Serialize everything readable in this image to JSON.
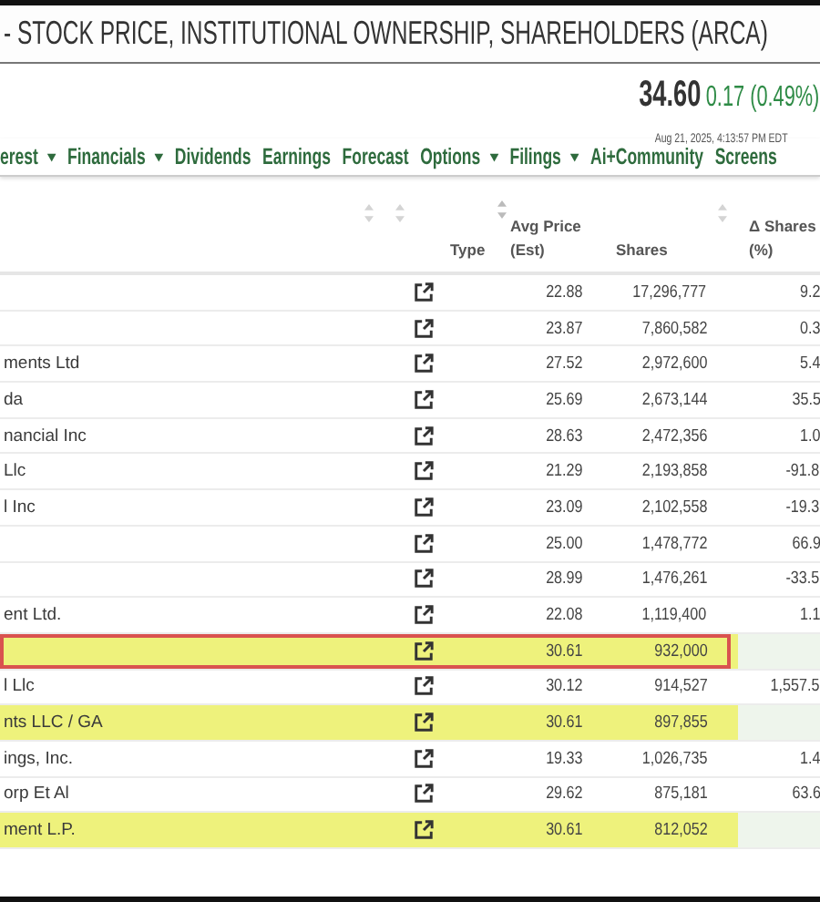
{
  "page_title": "- STOCK PRICE, INSTITUTIONAL OWNERSHIP, SHAREHOLDERS (ARCA)",
  "quote": {
    "price": "34.60",
    "change": "0.17 (0.49%)",
    "timestamp": "Aug 21, 2025, 4:13:57 PM EDT"
  },
  "nav": [
    {
      "label": "erest",
      "dropdown": true
    },
    {
      "label": "Financials",
      "dropdown": true
    },
    {
      "label": "Dividends",
      "dropdown": false
    },
    {
      "label": "Earnings",
      "dropdown": false
    },
    {
      "label": "Forecast",
      "dropdown": false
    },
    {
      "label": "Options",
      "dropdown": true
    },
    {
      "label": "Filings",
      "dropdown": true
    },
    {
      "label": "Ai+Community",
      "dropdown": false
    },
    {
      "label": "Screens",
      "dropdown": false
    }
  ],
  "table": {
    "headers": {
      "type": "Type",
      "avg_price": [
        "Avg Price",
        "(Est)"
      ],
      "shares": "Shares",
      "change_pct": [
        "Δ Shares",
        "(%)"
      ]
    },
    "rows": [
      {
        "name": "",
        "avg_price": "22.88",
        "shares": "17,296,777",
        "change_pct": "9.2",
        "highlighted": false,
        "outlined": false
      },
      {
        "name": "",
        "avg_price": "23.87",
        "shares": "7,860,582",
        "change_pct": "0.3",
        "highlighted": false,
        "outlined": false
      },
      {
        "name": "ments Ltd",
        "avg_price": "27.52",
        "shares": "2,972,600",
        "change_pct": "5.4",
        "highlighted": false,
        "outlined": false
      },
      {
        "name": "da",
        "avg_price": "25.69",
        "shares": "2,673,144",
        "change_pct": "35.5",
        "highlighted": false,
        "outlined": false
      },
      {
        "name": "nancial Inc",
        "avg_price": "28.63",
        "shares": "2,472,356",
        "change_pct": "1.0",
        "highlighted": false,
        "outlined": false
      },
      {
        "name": "Llc",
        "avg_price": "21.29",
        "shares": "2,193,858",
        "change_pct": "-91.8",
        "highlighted": false,
        "outlined": false
      },
      {
        "name": "l Inc",
        "avg_price": "23.09",
        "shares": "2,102,558",
        "change_pct": "-19.3",
        "highlighted": false,
        "outlined": false
      },
      {
        "name": "",
        "avg_price": "25.00",
        "shares": "1,478,772",
        "change_pct": "66.9",
        "highlighted": false,
        "outlined": false
      },
      {
        "name": "",
        "avg_price": "28.99",
        "shares": "1,476,261",
        "change_pct": "-33.5",
        "highlighted": false,
        "outlined": false
      },
      {
        "name": "ent Ltd.",
        "avg_price": "22.08",
        "shares": "1,119,400",
        "change_pct": "1.1",
        "highlighted": false,
        "outlined": false
      },
      {
        "name": "",
        "avg_price": "30.61",
        "shares": "932,000",
        "change_pct": "",
        "highlighted": true,
        "outlined": true
      },
      {
        "name": "l Llc",
        "avg_price": "30.12",
        "shares": "914,527",
        "change_pct": "1,557.5",
        "highlighted": false,
        "outlined": false
      },
      {
        "name": "nts LLC / GA",
        "avg_price": "30.61",
        "shares": "897,855",
        "change_pct": "",
        "highlighted": true,
        "outlined": false
      },
      {
        "name": "ings, Inc.",
        "avg_price": "19.33",
        "shares": "1,026,735",
        "change_pct": "1.4",
        "highlighted": false,
        "outlined": false
      },
      {
        "name": "orp Et Al",
        "avg_price": "29.62",
        "shares": "875,181",
        "change_pct": "63.6",
        "highlighted": false,
        "outlined": false
      },
      {
        "name": "ment L.P.",
        "avg_price": "30.61",
        "shares": "812,052",
        "change_pct": "",
        "highlighted": true,
        "outlined": false
      }
    ]
  }
}
